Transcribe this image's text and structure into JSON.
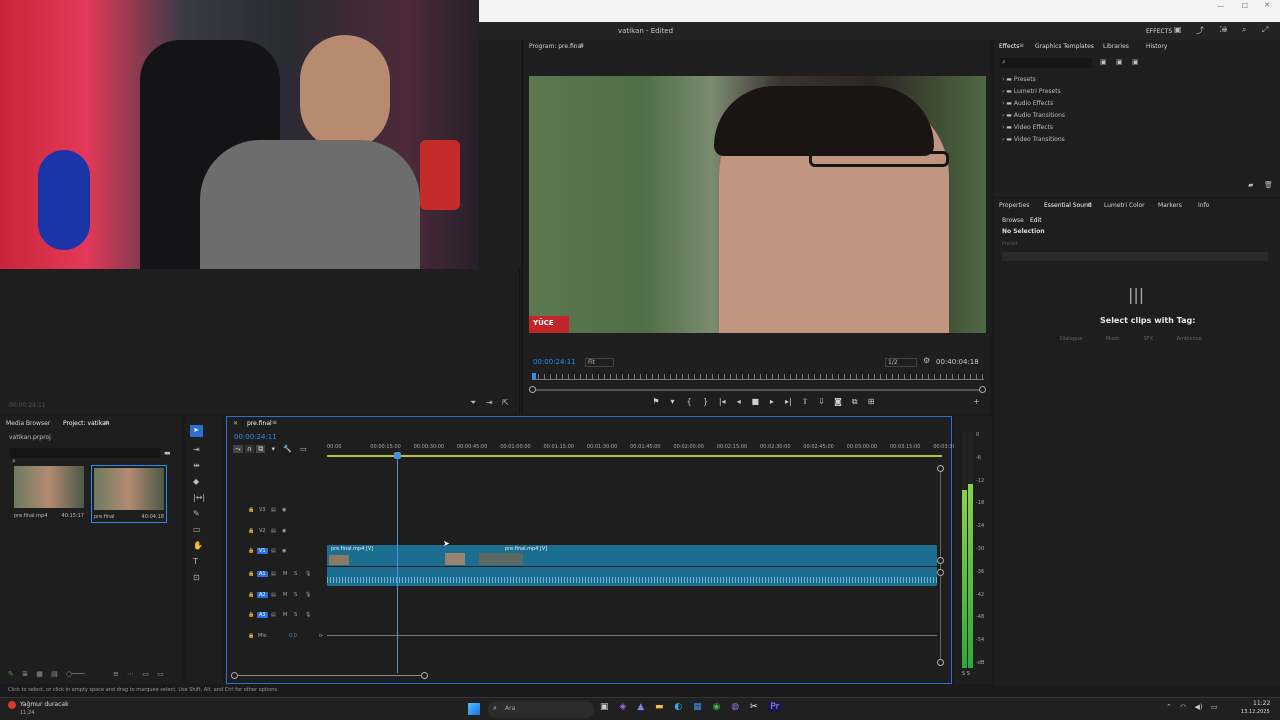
{
  "window": {
    "title": "vatikan - Edited",
    "effects_label": "EFFECTS"
  },
  "source_panel": {
    "timecode": "00:00:24:11"
  },
  "program": {
    "title": "Program: pre.final",
    "timecode_left": "00:00:24:11",
    "fit": "Fit",
    "resolution": "1/2",
    "timecode_right": "00:40:04:18",
    "overlay_text": "YÜCE"
  },
  "effects_panel": {
    "tabs": [
      "Effects",
      "Graphics Templates",
      "Libraries",
      "History"
    ],
    "items": [
      "Presets",
      "Lumetri Presets",
      "Audio Effects",
      "Audio Transitions",
      "Video Effects",
      "Video Transitions"
    ]
  },
  "essential_sound": {
    "tabs": [
      "Properties",
      "Essential Sound",
      "Lumetri Color",
      "Markers",
      "Info"
    ],
    "subtabs": [
      "Browse",
      "Edit"
    ],
    "no_selection": "No Selection",
    "preset_label": "Preset",
    "select_clips": "Select clips with Tag:",
    "tags": [
      "Dialogue",
      "Music",
      "SFX",
      "Ambience"
    ]
  },
  "project": {
    "tabs": [
      "Media Browser",
      "Project: vatikan"
    ],
    "file": "vatikan.prproj",
    "items": [
      {
        "name": "pre.final.mp4",
        "duration": "40:15:17"
      },
      {
        "name": "pre.final",
        "duration": "40:04:18"
      }
    ]
  },
  "timeline": {
    "tab": "pre.final",
    "timecode": "00:00:24:11",
    "ruler": [
      "00:00",
      "00:00:15:00",
      "00:00:30:00",
      "00:00:45:00",
      "00:01:00:00",
      "00:01:15:00",
      "00:01:30:00",
      "00:01:45:00",
      "00:02:00:00",
      "00:02:15:00",
      "00:02:30:00",
      "00:02:45:00",
      "00:03:00:00",
      "00:03:15:00",
      "00:03:30:00"
    ],
    "tracks": [
      "V3",
      "V2",
      "V1",
      "A1",
      "A2",
      "A3"
    ],
    "mix": {
      "label": "Mix",
      "value": "0.0"
    },
    "clips": [
      "pre.final.mp4 [V]",
      "pre.final.mp4 [V]"
    ]
  },
  "meter": {
    "labels": [
      "0",
      "-6",
      "-12",
      "-18",
      "-24",
      "-30",
      "-36",
      "-42",
      "-48",
      "-54",
      "-dB"
    ],
    "footer": "S S"
  },
  "status_bar": "Click to select, or click in empty space and drag to marquee select. Use Shift, Alt, and Ctrl for other options.",
  "taskbar": {
    "weather_title": "Yağmur duracak",
    "weather_sub": "11:24",
    "search": "Ara",
    "time": "11:22",
    "date": "13.12.2025"
  }
}
